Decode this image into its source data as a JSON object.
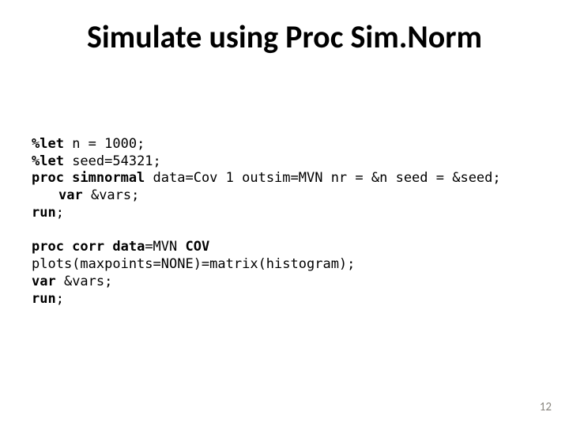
{
  "title": "Simulate using Proc Sim.Norm",
  "code": {
    "let1_kw": "%let",
    "let1_rest": " n = 1000;",
    "let2_kw": "%let",
    "let2_rest": " seed=54321;",
    "proc1_kw": "proc simnormal",
    "proc1_rest": " data=Cov 1 outsim=MVN nr = &n seed = &seed;",
    "varline1_kw": "var",
    "varline1_rest": " &vars;",
    "run1_kw": "run",
    "run1_rest": ";",
    "blank": "",
    "proc2_a": "proc corr ",
    "proc2_b": "data",
    "proc2_c": "=MVN ",
    "proc2_d": "COV",
    "plotsline": "plots(maxpoints=NONE)=matrix(histogram);",
    "varline2_kw": "var",
    "varline2_rest": " &vars;",
    "run2_kw": "run",
    "run2_rest": ";"
  },
  "page_number": "12"
}
